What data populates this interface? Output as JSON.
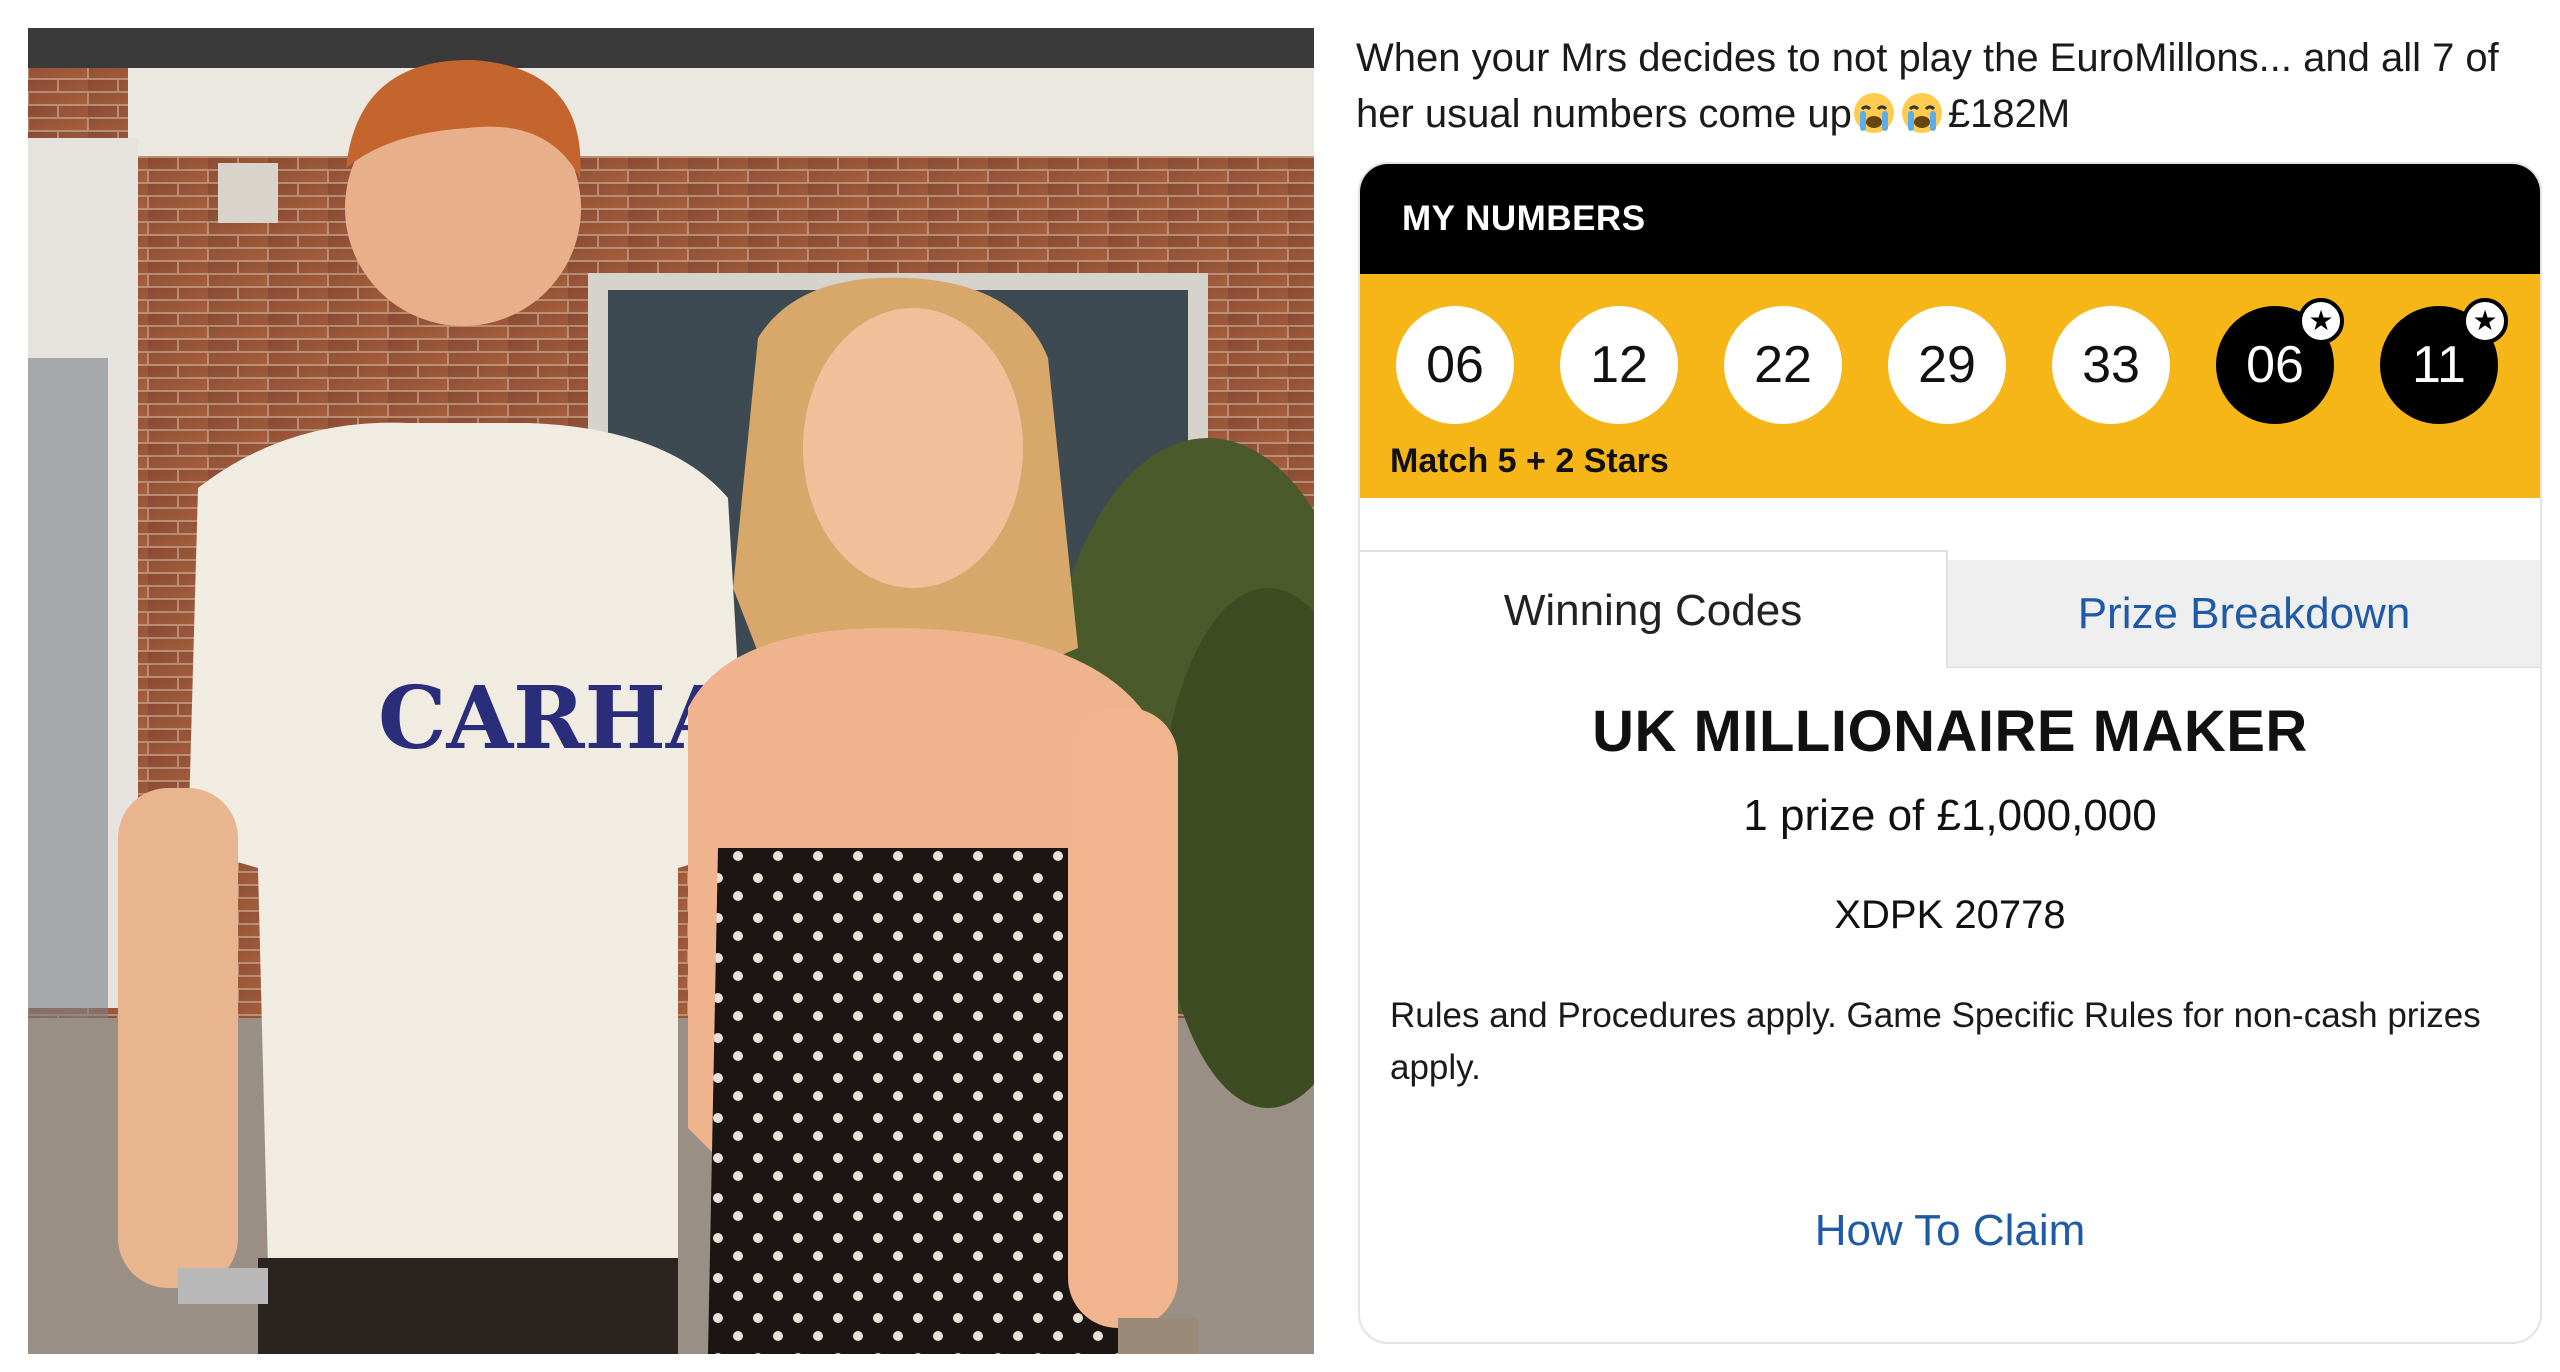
{
  "tweet": {
    "text_before": "When your Mrs decides to not play the EuroMillons... and all 7 of her usual numbers come up",
    "emojis": [
      "loudly-crying-face",
      "loudly-crying-face"
    ],
    "text_after": "£182M"
  },
  "photo": {
    "shirt_text": "CARHARTT"
  },
  "card": {
    "header": "MY NUMBERS",
    "main_numbers": [
      "06",
      "12",
      "22",
      "29",
      "33"
    ],
    "star_numbers": [
      "06",
      "11"
    ],
    "match_label": "Match 5 + 2 Stars",
    "tabs": [
      {
        "label": "Winning Codes",
        "active": true
      },
      {
        "label": "Prize Breakdown",
        "active": false
      }
    ],
    "prize_title": "UK MILLIONAIRE MAKER",
    "prize_subtitle": "1 prize of £1,000,000",
    "prize_code": "XDPK 20778",
    "rules": "Rules and Procedures apply. Game Specific Rules for non-cash prizes apply.",
    "claim_link": "How To Claim"
  },
  "colors": {
    "header_bg": "#000000",
    "strip_bg": "#f7b618",
    "link_blue": "#1f5aa6"
  }
}
